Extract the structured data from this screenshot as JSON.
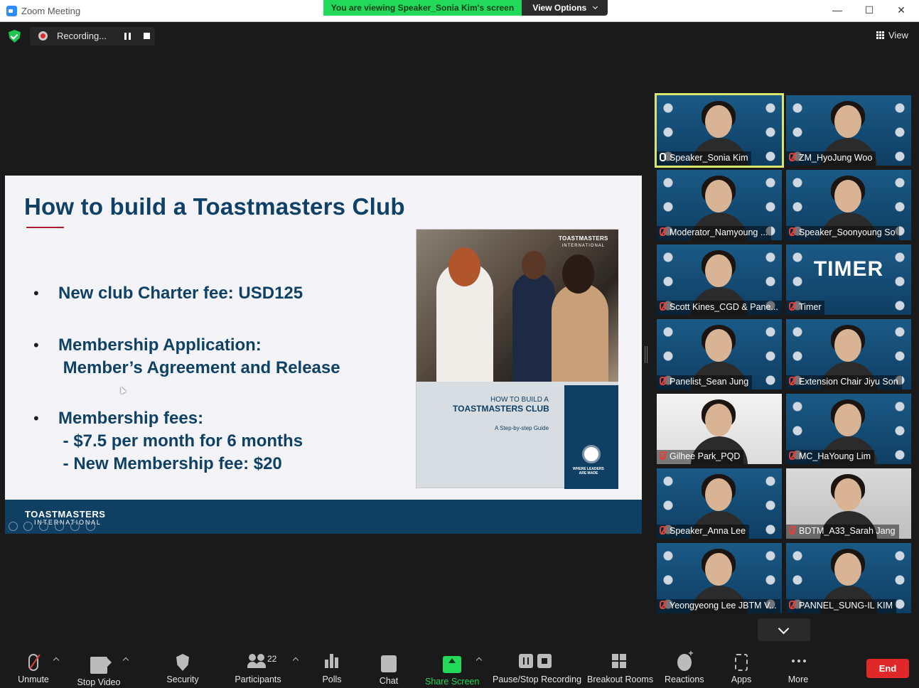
{
  "window": {
    "title": "Zoom Meeting",
    "controls": [
      "—",
      "☐",
      "✕"
    ]
  },
  "banner": {
    "viewing_text": "You are viewing Speaker_Sonia Kim's screen",
    "view_options_label": "View Options"
  },
  "recording": {
    "label": "Recording..."
  },
  "view_button": {
    "label": "View"
  },
  "slide": {
    "title": "How to build a Toastmasters Club",
    "bullets": [
      "New club Charter fee: USD125",
      "Membership Application:\n Member’s Agreement and Release",
      "Membership fees:\n - $7.5 per month for 6 months\n - New Membership fee: $20"
    ],
    "footer_brand": "TOASTMASTERS",
    "footer_brand_sub": "INTERNATIONAL",
    "book": {
      "brand": "TOASTMASTERS",
      "brand_sub": "INTERNATIONAL",
      "line1": "HOW TO BUILD A",
      "line2": "TOASTMASTERS CLUB",
      "line3": "A Step-by-step Guide",
      "tagline": "WHERE LEADERS\nARE MADE"
    }
  },
  "participants": [
    {
      "name": "Speaker_Sonia Kim",
      "muted": false,
      "active": true,
      "bg": "blue"
    },
    {
      "name": "ZM_HyoJung Woo",
      "muted": true,
      "active": false,
      "bg": "blue"
    },
    {
      "name": "Moderator_Namyoung ...",
      "muted": true,
      "active": false,
      "bg": "blue"
    },
    {
      "name": "Speaker_Soonyoung So",
      "muted": true,
      "active": false,
      "bg": "blue"
    },
    {
      "name": "Scott Kines_CGD & Pane...",
      "muted": true,
      "active": false,
      "bg": "blue"
    },
    {
      "name": "Timer",
      "muted": true,
      "active": false,
      "bg": "blue",
      "tile_text": "TIMER"
    },
    {
      "name": "Panelist_Sean Jung",
      "muted": true,
      "active": false,
      "bg": "blue"
    },
    {
      "name": "Extension Chair Jiyu Son",
      "muted": true,
      "active": false,
      "bg": "blue"
    },
    {
      "name": "Gilhee Park_PQD",
      "muted": true,
      "active": false,
      "bg": "light"
    },
    {
      "name": "MC_HaYoung Lim",
      "muted": true,
      "active": false,
      "bg": "blue"
    },
    {
      "name": "Speaker_Anna Lee",
      "muted": true,
      "active": false,
      "bg": "blue"
    },
    {
      "name": "BDTM_A33_Sarah Jang",
      "muted": true,
      "active": false,
      "bg": "grey"
    },
    {
      "name": "Yeongyeong Lee JBTM V...",
      "muted": true,
      "active": false,
      "bg": "blue"
    },
    {
      "name": "PANNEL_SUNG-IL KIM",
      "muted": true,
      "active": false,
      "bg": "blue"
    }
  ],
  "toolbar": {
    "unmute": "Unmute",
    "stop_video": "Stop Video",
    "security": "Security",
    "participants": "Participants",
    "participants_count": "22",
    "polls": "Polls",
    "chat": "Chat",
    "share_screen": "Share Screen",
    "pause_stop_recording": "Pause/Stop Recording",
    "breakout_rooms": "Breakout Rooms",
    "reactions": "Reactions",
    "apps": "Apps",
    "more": "More",
    "end": "End"
  },
  "colors": {
    "share_green": "#23d959",
    "end_red": "#e02828",
    "slide_navy": "#0f3f63",
    "active_speaker_outline": "#d9e86a"
  }
}
